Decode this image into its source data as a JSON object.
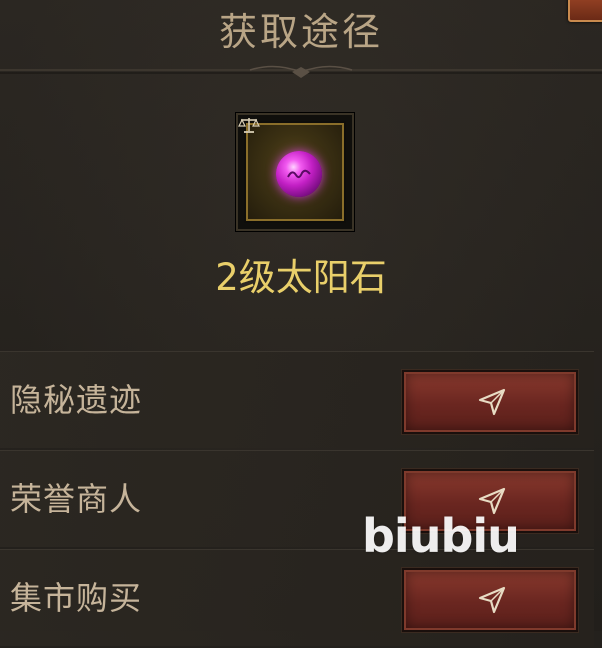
{
  "panel": {
    "title": "获取途径"
  },
  "item": {
    "name": "2级太阳石",
    "icon": "sun-stone-gem-icon",
    "badge_icon": "scale-icon",
    "gem_color": "#d93ad6",
    "frame_color": "#8a6e2a"
  },
  "sources": [
    {
      "label": "隐秘遗迹",
      "action_icon": "navigate-arrow-icon"
    },
    {
      "label": "荣誉商人",
      "action_icon": "navigate-arrow-icon"
    },
    {
      "label": "集市购买",
      "action_icon": "navigate-arrow-icon"
    }
  ],
  "watermark": {
    "text": "biubiu"
  },
  "colors": {
    "title": "#b9a586",
    "item_name": "#e9cf6a",
    "row_label": "#c6b49a",
    "button": "#7a2f26"
  }
}
